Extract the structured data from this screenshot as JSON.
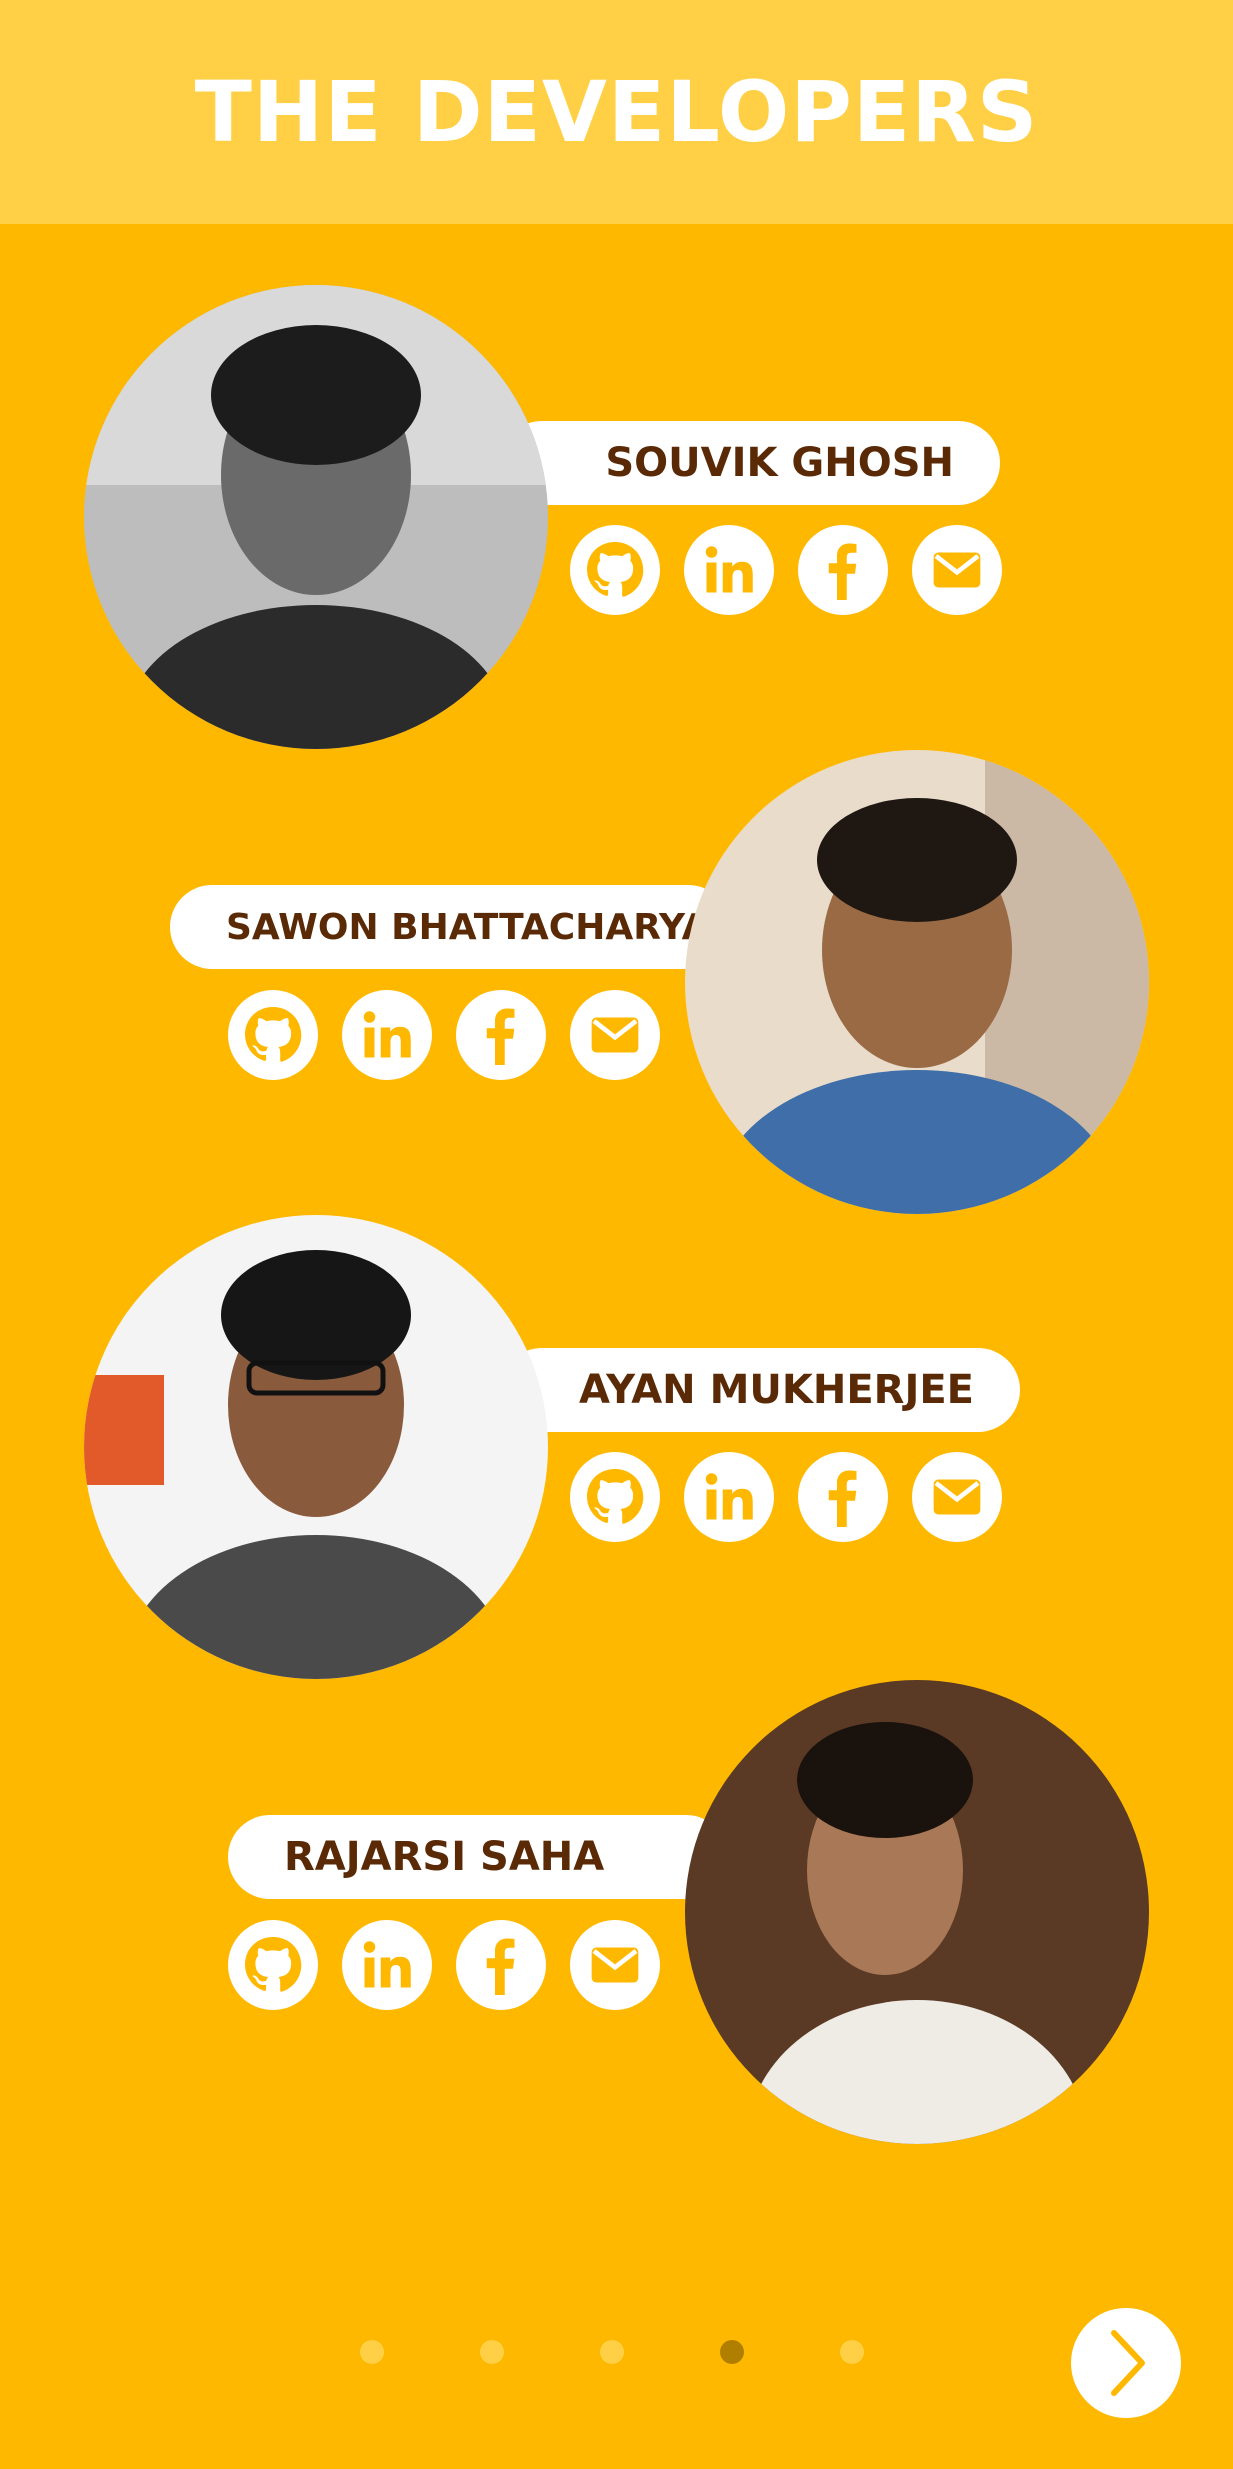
{
  "header": {
    "title": "THE DEVELOPERS"
  },
  "developers": [
    {
      "name": "SOUVIK GHOSH"
    },
    {
      "name": "SAWON BHATTACHARYA"
    },
    {
      "name": "AYAN MUKHERJEE"
    },
    {
      "name": "RAJARSI SAHA"
    }
  ],
  "social_icons": [
    "github-icon",
    "linkedin-icon",
    "facebook-icon",
    "mail-icon"
  ],
  "pager": {
    "total_dots": 5,
    "active_index": 3
  },
  "colors": {
    "background": "#FFB800",
    "header": "#FFD045",
    "name_text": "#5A2A06",
    "icon": "#FFB800",
    "dot": "#FFD045",
    "dot_active": "#B07F00"
  }
}
